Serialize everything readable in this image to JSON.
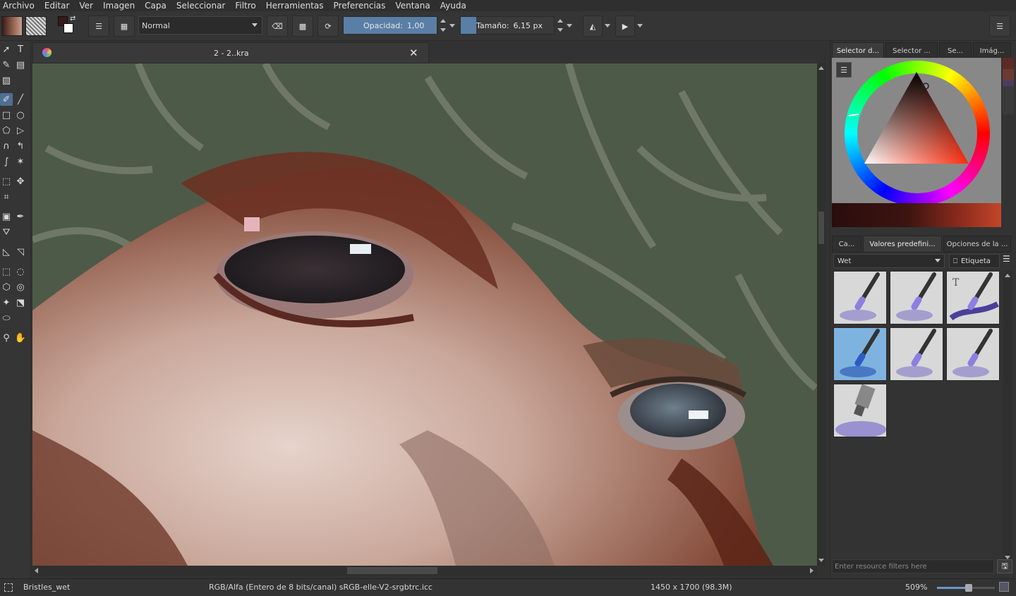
{
  "menu": [
    "Archivo",
    "Editar",
    "Ver",
    "Imagen",
    "Capa",
    "Seleccionar",
    "Filtro",
    "Herramientas",
    "Preferencias",
    "Ventana",
    "Ayuda"
  ],
  "toolbar": {
    "blend_mode": "Normal",
    "opacity_label": "Opacidad:",
    "opacity_value": "1,00",
    "opacity_fraction": 1.0,
    "size_label": "Tamaño:",
    "size_value": "6,15 px",
    "size_fraction": 0.17,
    "foreground_color": "#3a1a18",
    "background_color": "#ffffff"
  },
  "document": {
    "tab_title": "2 - 2..kra"
  },
  "docker": {
    "top_tabs": [
      "Selector d...",
      "Selector ...",
      "Se...",
      "Imág..."
    ],
    "preset_tabs": [
      "Ca...",
      "Valores predefini...",
      "Opciones de la ..."
    ],
    "preset_group": "Wet",
    "tag_label": "Etiqueta",
    "filter_placeholder": "Enter resource filters here",
    "presets": [
      {
        "icon": "wet-brush-preset-icon"
      },
      {
        "icon": "wet-brush-preset-icon"
      },
      {
        "icon": "wet-text-brush-preset-icon"
      },
      {
        "icon": "wet-brush-preset-icon",
        "selected": true
      },
      {
        "icon": "wet-brush-preset-icon"
      },
      {
        "icon": "wet-brush-preset-icon"
      },
      {
        "icon": "paint-tube-preset-icon"
      }
    ]
  },
  "status": {
    "brush_name": "Bristles_wet",
    "color_info": "RGB/Alfa (Entero de 8 bits/canal)  sRGB-elle-V2-srgbtrc.icc",
    "dimensions": "1450 x 1700 (98.3M)",
    "zoom": "509%",
    "zoom_fraction": 0.55
  },
  "colors": {
    "accent": "#5a7fa6",
    "panel": "#333333"
  }
}
